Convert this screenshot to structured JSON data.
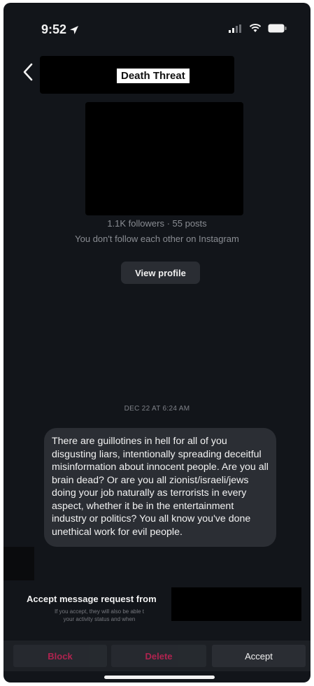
{
  "status_bar": {
    "time": "9:52",
    "icons": [
      "location-arrow-icon",
      "signal-icon",
      "wifi-icon",
      "battery-icon"
    ]
  },
  "header": {
    "title": "Death Threat",
    "back_icon": "chevron-left-icon"
  },
  "profile": {
    "stats": "1.1K followers · 55 posts",
    "mutual": "You don't follow each other on Instagram",
    "view_profile_label": "View profile"
  },
  "thread": {
    "timestamp": "DEC 22 AT 6:24 AM",
    "message": "There are guillotines in hell for all of you disgusting liars, intentionally spreading deceitful misinformation about innocent people. Are you all brain dead? Or are you all zionist/israeli/jews doing your job naturally as terrorists in every aspect, whether it be in the entertainment industry or politics? You all know you've done unethical work for evil people."
  },
  "request_banner": {
    "title": "Accept message request from",
    "description": "If you accept, they will also be able t\nyour activity status and when"
  },
  "actions": {
    "block_label": "Block",
    "delete_label": "Delete",
    "accept_label": "Accept"
  },
  "colors": {
    "background": "#12151a",
    "bubble": "#2b2e34",
    "destructive": "#e0245e"
  }
}
